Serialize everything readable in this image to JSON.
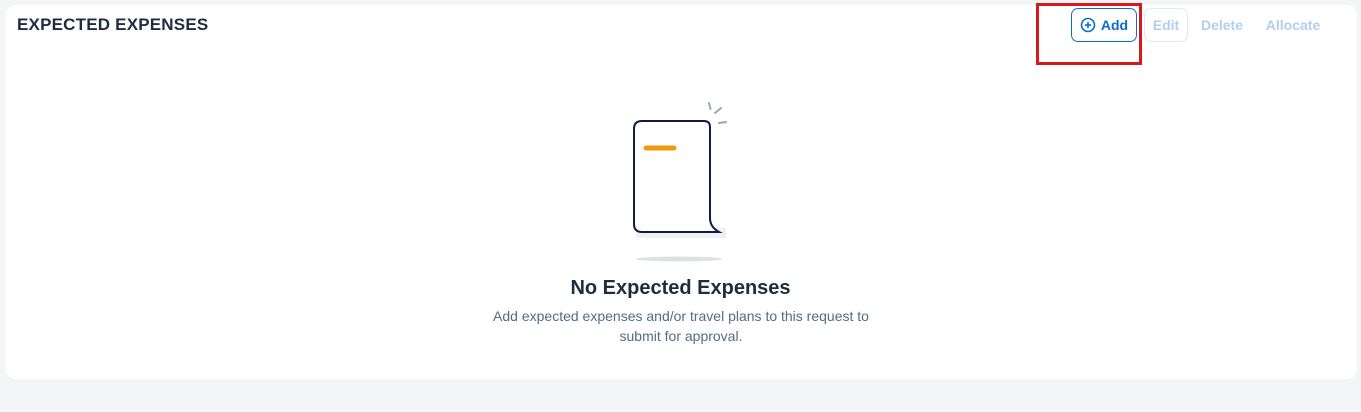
{
  "section": {
    "title": "EXPECTED EXPENSES"
  },
  "toolbar": {
    "add_label": "Add",
    "edit_label": "Edit",
    "delete_label": "Delete",
    "allocate_label": "Allocate",
    "add_icon": "plus-circle-icon"
  },
  "empty_state": {
    "illustration": "empty-document-icon",
    "title": "No Expected Expenses",
    "description": "Add expected expenses and/or travel plans to this request to submit for approval."
  },
  "colors": {
    "accent": "#0a6ed1",
    "disabled_text": "#b0cff2",
    "highlight_box": "#d7191f",
    "doc_accent": "#f09a12",
    "doc_outline": "#0f1b47"
  }
}
